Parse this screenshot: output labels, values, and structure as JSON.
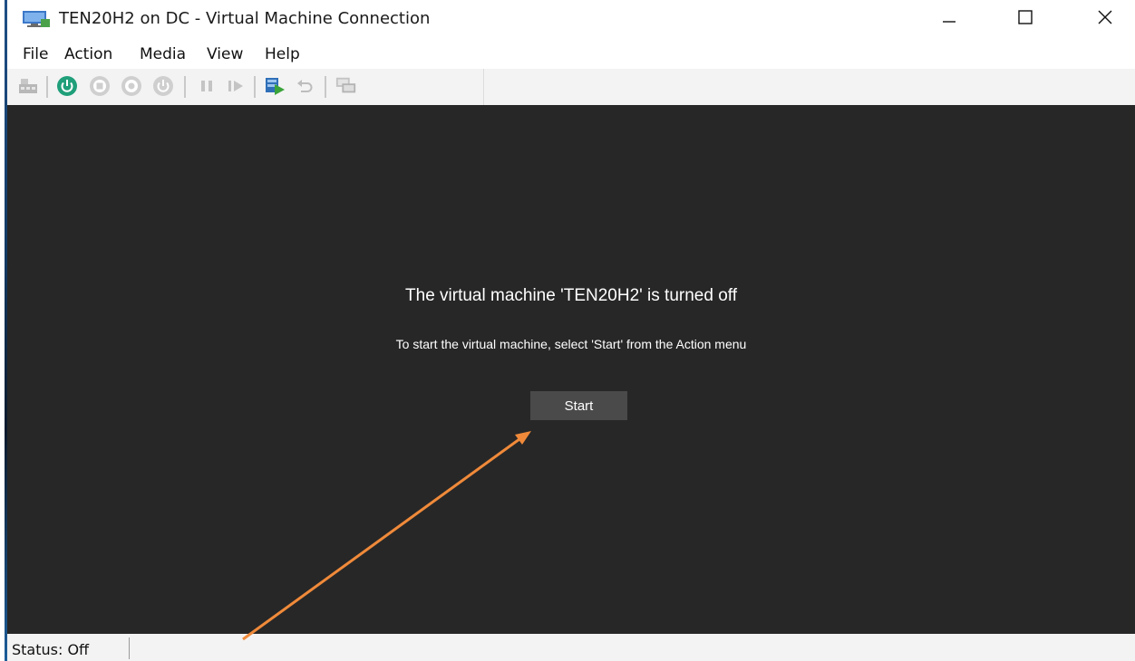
{
  "window": {
    "title": "TEN20H2 on DC - Virtual Machine Connection",
    "controls": [
      "minimize-icon",
      "maximize-icon",
      "close-icon"
    ]
  },
  "menu": {
    "items": [
      {
        "label": "File"
      },
      {
        "label": "Action"
      },
      {
        "label": "Media"
      },
      {
        "label": "View"
      },
      {
        "label": "Help"
      }
    ]
  },
  "toolbar": {
    "icons": [
      "ctrl-alt-del-icon",
      "start-icon",
      "turn-off-icon",
      "shut-down-icon",
      "save-icon",
      "pause-icon",
      "resume-icon",
      "checkpoint-icon",
      "revert-icon",
      "enhanced-session-icon"
    ]
  },
  "vm": {
    "heading": "The virtual machine 'TEN20H2' is turned off",
    "instruction": "To start the virtual machine, select 'Start' from the Action menu",
    "start_button_label": "Start"
  },
  "status": {
    "text": "Status: Off"
  },
  "colors": {
    "vm_background": "#272727",
    "start_button": "#4a4a4a",
    "start_icon_green": "#1f9f7a",
    "annotation_arrow": "#f08a3a"
  }
}
